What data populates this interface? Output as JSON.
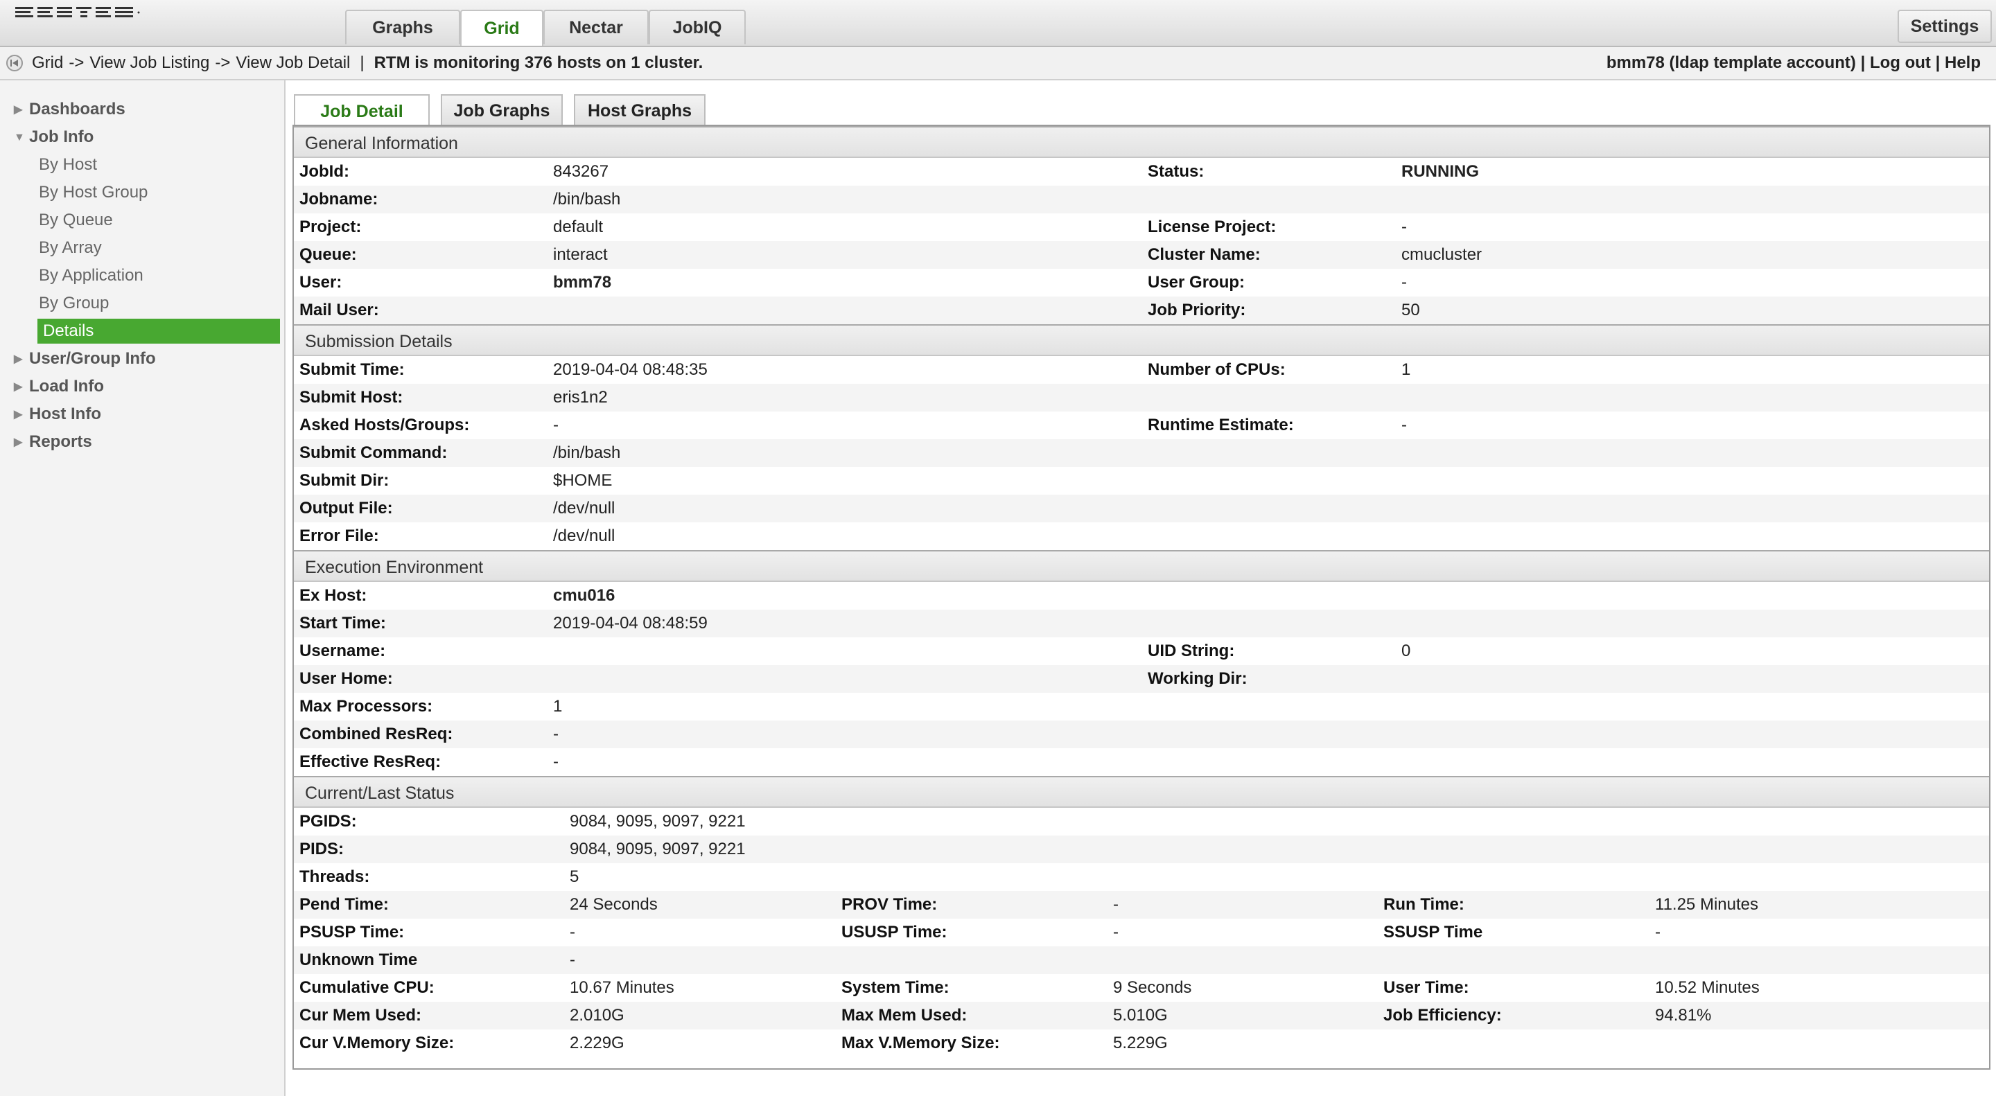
{
  "topnav": {
    "tabs": [
      {
        "label": "Graphs",
        "active": false
      },
      {
        "label": "Grid",
        "active": true
      },
      {
        "label": "Nectar",
        "active": false
      },
      {
        "label": "JobIQ",
        "active": false
      }
    ],
    "settings_label": "Settings"
  },
  "breadcrumb": {
    "items": [
      "Grid",
      "View Job Listing",
      "View Job Detail"
    ],
    "separator": "->",
    "divider": "|",
    "status": "RTM is monitoring 376 hosts on 1 cluster."
  },
  "user": {
    "account": "bmm78 (ldap template account)",
    "divider": "|",
    "logout_label": "Log out",
    "help_label": "Help"
  },
  "sidebar": {
    "items": [
      {
        "label": "Dashboards",
        "level": 0,
        "expanded": false
      },
      {
        "label": "Job Info",
        "level": 0,
        "expanded": true
      },
      {
        "label": "By Host",
        "level": 1
      },
      {
        "label": "By Host Group",
        "level": 1
      },
      {
        "label": "By Queue",
        "level": 1
      },
      {
        "label": "By Array",
        "level": 1
      },
      {
        "label": "By Application",
        "level": 1
      },
      {
        "label": "By Group",
        "level": 1
      },
      {
        "label": "Details",
        "level": 1,
        "active": true
      },
      {
        "label": "User/Group Info",
        "level": 0,
        "expanded": false
      },
      {
        "label": "Load Info",
        "level": 0,
        "expanded": false
      },
      {
        "label": "Host Info",
        "level": 0,
        "expanded": false
      },
      {
        "label": "Reports",
        "level": 0,
        "expanded": false
      }
    ]
  },
  "content_tabs": [
    {
      "label": "Job Detail",
      "active": true
    },
    {
      "label": "Job Graphs",
      "active": false
    },
    {
      "label": "Host Graphs",
      "active": false
    }
  ],
  "sections": {
    "general": {
      "title": "General Information",
      "rows": [
        [
          "JobId:",
          "843267",
          "Status:",
          "RUNNING"
        ],
        [
          "Jobname:",
          "/bin/bash",
          "",
          ""
        ],
        [
          "Project:",
          "default",
          "License Project:",
          "-"
        ],
        [
          "Queue:",
          "interact",
          "Cluster Name:",
          "cmucluster"
        ],
        [
          "User:",
          "bmm78",
          "User Group:",
          "-"
        ],
        [
          "Mail User:",
          "",
          "Job Priority:",
          "50"
        ]
      ]
    },
    "submission": {
      "title": "Submission Details",
      "rows": [
        [
          "Submit Time:",
          "2019-04-04 08:48:35",
          "Number of CPUs:",
          "1"
        ],
        [
          "Submit Host:",
          "eris1n2",
          "",
          ""
        ],
        [
          "Asked Hosts/Groups:",
          "-",
          "Runtime Estimate:",
          "-"
        ],
        [
          "Submit Command:",
          "/bin/bash",
          "",
          ""
        ],
        [
          "Submit Dir:",
          "$HOME",
          "",
          ""
        ],
        [
          "Output File:",
          "/dev/null",
          "",
          ""
        ],
        [
          "Error File:",
          "/dev/null",
          "",
          ""
        ]
      ]
    },
    "execution": {
      "title": "Execution Environment",
      "rows": [
        [
          "Ex Host:",
          "cmu016",
          "",
          ""
        ],
        [
          "Start Time:",
          "2019-04-04 08:48:59",
          "",
          ""
        ],
        [
          "Username:",
          "",
          "UID String:",
          "0"
        ],
        [
          "User Home:",
          "",
          "Working Dir:",
          ""
        ],
        [
          "Max Processors:",
          "1",
          "",
          ""
        ],
        [
          "Combined ResReq:",
          "-",
          "",
          ""
        ],
        [
          "Effective ResReq:",
          "-",
          "",
          ""
        ]
      ]
    },
    "status": {
      "title": "Current/Last Status",
      "rows": [
        [
          "PGIDS:",
          "9084, 9095, 9097, 9221",
          "",
          "",
          "",
          ""
        ],
        [
          "PIDS:",
          "9084, 9095, 9097, 9221",
          "",
          "",
          "",
          ""
        ],
        [
          "Threads:",
          "5",
          "",
          "",
          "",
          ""
        ],
        [
          "Pend Time:",
          "24 Seconds",
          "PROV Time:",
          "-",
          "Run Time:",
          "11.25 Minutes"
        ],
        [
          "PSUSP Time:",
          "-",
          "USUSP Time:",
          "-",
          "SSUSP Time",
          "-"
        ],
        [
          "Unknown Time",
          "-",
          "",
          "",
          "",
          ""
        ],
        [
          "Cumulative CPU:",
          "10.67 Minutes",
          "System Time:",
          "9 Seconds",
          "User Time:",
          "10.52 Minutes"
        ],
        [
          "Cur Mem Used:",
          "2.010G",
          "Max Mem Used:",
          "5.010G",
          "Job Efficiency:",
          "94.81%"
        ],
        [
          "Cur V.Memory Size:",
          "2.229G",
          "Max V.Memory Size:",
          "5.229G",
          "",
          ""
        ]
      ]
    }
  }
}
